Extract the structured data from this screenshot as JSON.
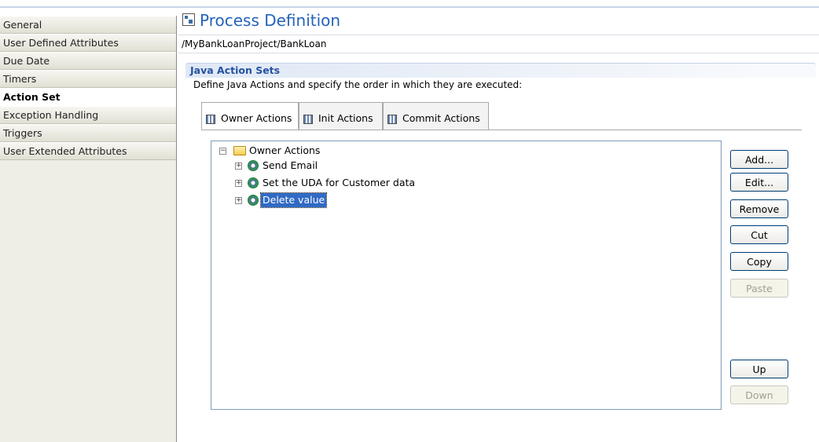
{
  "sidebar": {
    "items": [
      {
        "label": "General"
      },
      {
        "label": "User Defined Attributes"
      },
      {
        "label": "Due Date"
      },
      {
        "label": "Timers"
      },
      {
        "label": "Action Set",
        "selected": true
      },
      {
        "label": "Exception Handling"
      },
      {
        "label": "Triggers"
      },
      {
        "label": "User Extended Attributes"
      }
    ]
  },
  "header": {
    "title": "Process Definition",
    "path": "/MyBankLoanProject/BankLoan",
    "icon": "process-definition-icon"
  },
  "section": {
    "title": "Java Action Sets",
    "description": "Define Java Actions and specify the order in which they are executed:"
  },
  "tabs": [
    {
      "label": "Owner Actions",
      "active": true,
      "icon": "action-tab-icon"
    },
    {
      "label": "Init Actions",
      "active": false,
      "icon": "action-tab-icon"
    },
    {
      "label": "Commit Actions",
      "active": false,
      "icon": "action-tab-icon"
    }
  ],
  "tree": {
    "root": {
      "label": "Owner Actions",
      "expanded": true,
      "icon": "folder-open-icon"
    },
    "children": [
      {
        "label": "Send Email",
        "icon": "gear-icon",
        "selected": false
      },
      {
        "label": "Set the UDA for Customer data",
        "icon": "gear-icon",
        "selected": false
      },
      {
        "label": "Delete value",
        "icon": "gear-icon",
        "selected": true
      }
    ]
  },
  "buttons": {
    "add": {
      "label": "Add...",
      "enabled": true
    },
    "edit": {
      "label": "Edit...",
      "enabled": true
    },
    "remove": {
      "label": "Remove",
      "enabled": true
    },
    "cut": {
      "label": "Cut",
      "enabled": true
    },
    "copy": {
      "label": "Copy",
      "enabled": true
    },
    "paste": {
      "label": "Paste",
      "enabled": false
    },
    "up": {
      "label": "Up",
      "enabled": true
    },
    "down": {
      "label": "Down",
      "enabled": false
    }
  },
  "colors": {
    "title": "#2563ba",
    "section_title": "#2552a0",
    "selection": "#316ac5",
    "sidebar_bg": "#eeede6"
  }
}
